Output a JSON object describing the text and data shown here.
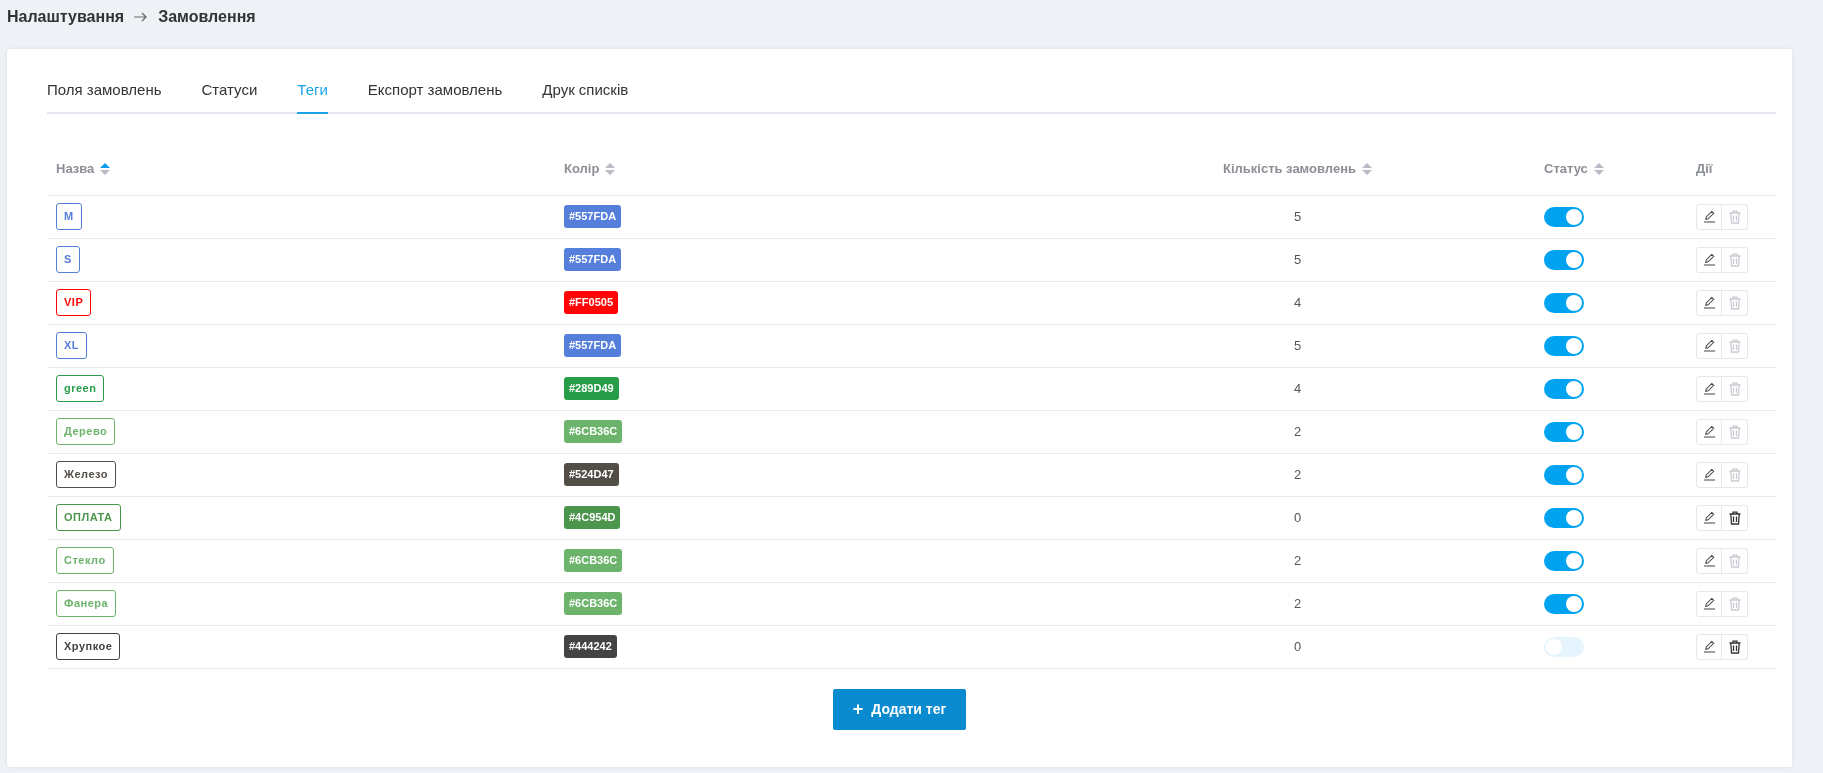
{
  "breadcrumb": {
    "items": [
      "Налаштування",
      "Замовлення"
    ]
  },
  "tabs": [
    {
      "label": "Поля замовлень",
      "selected": false
    },
    {
      "label": "Статуси",
      "selected": false
    },
    {
      "label": "Теги",
      "selected": true
    },
    {
      "label": "Експорт замовлень",
      "selected": false
    },
    {
      "label": "Друк списків",
      "selected": false
    }
  ],
  "table": {
    "columns": [
      {
        "label": "Назва",
        "sortable": true,
        "sorted": true
      },
      {
        "label": "Колір",
        "sortable": true,
        "sorted": false
      },
      {
        "label": "Кількість замовлень",
        "sortable": true,
        "sorted": false
      },
      {
        "label": "Статус",
        "sortable": true,
        "sorted": false
      },
      {
        "label": "Дії",
        "sortable": false
      }
    ],
    "rows": [
      {
        "name": "M",
        "color": "#557fda",
        "hex": "#557FDA",
        "count": "5",
        "on": true,
        "delete_disabled": true
      },
      {
        "name": "S",
        "color": "#557fda",
        "hex": "#557FDA",
        "count": "5",
        "on": true,
        "delete_disabled": true
      },
      {
        "name": "VIP",
        "color": "#ff0505",
        "hex": "#FF0505",
        "count": "4",
        "on": true,
        "delete_disabled": true
      },
      {
        "name": "XL",
        "color": "#557fda",
        "hex": "#557FDA",
        "count": "5",
        "on": true,
        "delete_disabled": true
      },
      {
        "name": "green",
        "color": "#289d49",
        "hex": "#289D49",
        "count": "4",
        "on": true,
        "delete_disabled": true
      },
      {
        "name": "Дерево",
        "color": "#6cb36c",
        "hex": "#6CB36C",
        "count": "2",
        "on": true,
        "delete_disabled": true
      },
      {
        "name": "Железо",
        "color": "#524d47",
        "hex": "#524D47",
        "count": "2",
        "on": true,
        "delete_disabled": true
      },
      {
        "name": "ОПЛАТА",
        "color": "#4c954d",
        "hex": "#4C954D",
        "count": "0",
        "on": true,
        "delete_disabled": false
      },
      {
        "name": "Стекло",
        "color": "#6cb36c",
        "hex": "#6CB36C",
        "count": "2",
        "on": true,
        "delete_disabled": true
      },
      {
        "name": "Фанера",
        "color": "#6cb36c",
        "hex": "#6CB36C",
        "count": "2",
        "on": true,
        "delete_disabled": true
      },
      {
        "name": "Хрупкое",
        "color": "#444242",
        "hex": "#444242",
        "count": "0",
        "on": false,
        "delete_disabled": false
      }
    ]
  },
  "add_button": {
    "icon": "+",
    "label": "Додати тег"
  }
}
